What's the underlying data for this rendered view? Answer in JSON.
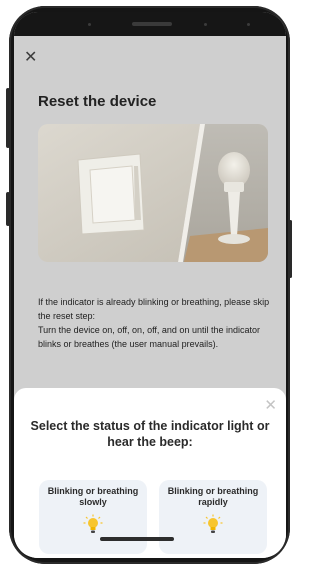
{
  "top_bar": {
    "close_icon": "close-icon"
  },
  "page": {
    "title": "Reset the device",
    "instructions": [
      "If the indicator is already blinking or breathing, please skip the reset step:",
      "Turn the device on, off, on, off, and on until the indicator blinks or breathes (the user manual prevails)."
    ]
  },
  "sheet": {
    "close_icon": "close-icon",
    "title": "Select the status of the indicator light or hear the beep:",
    "options": [
      {
        "label": "Blinking or breathing slowly",
        "icon": "lightbulb-icon"
      },
      {
        "label": "Blinking or breathing rapidly",
        "icon": "lightbulb-icon"
      }
    ]
  },
  "colors": {
    "overlay_bg": "#cfcfcf",
    "option_bg": "#eef2f7",
    "bulb": "#f7c52e"
  }
}
